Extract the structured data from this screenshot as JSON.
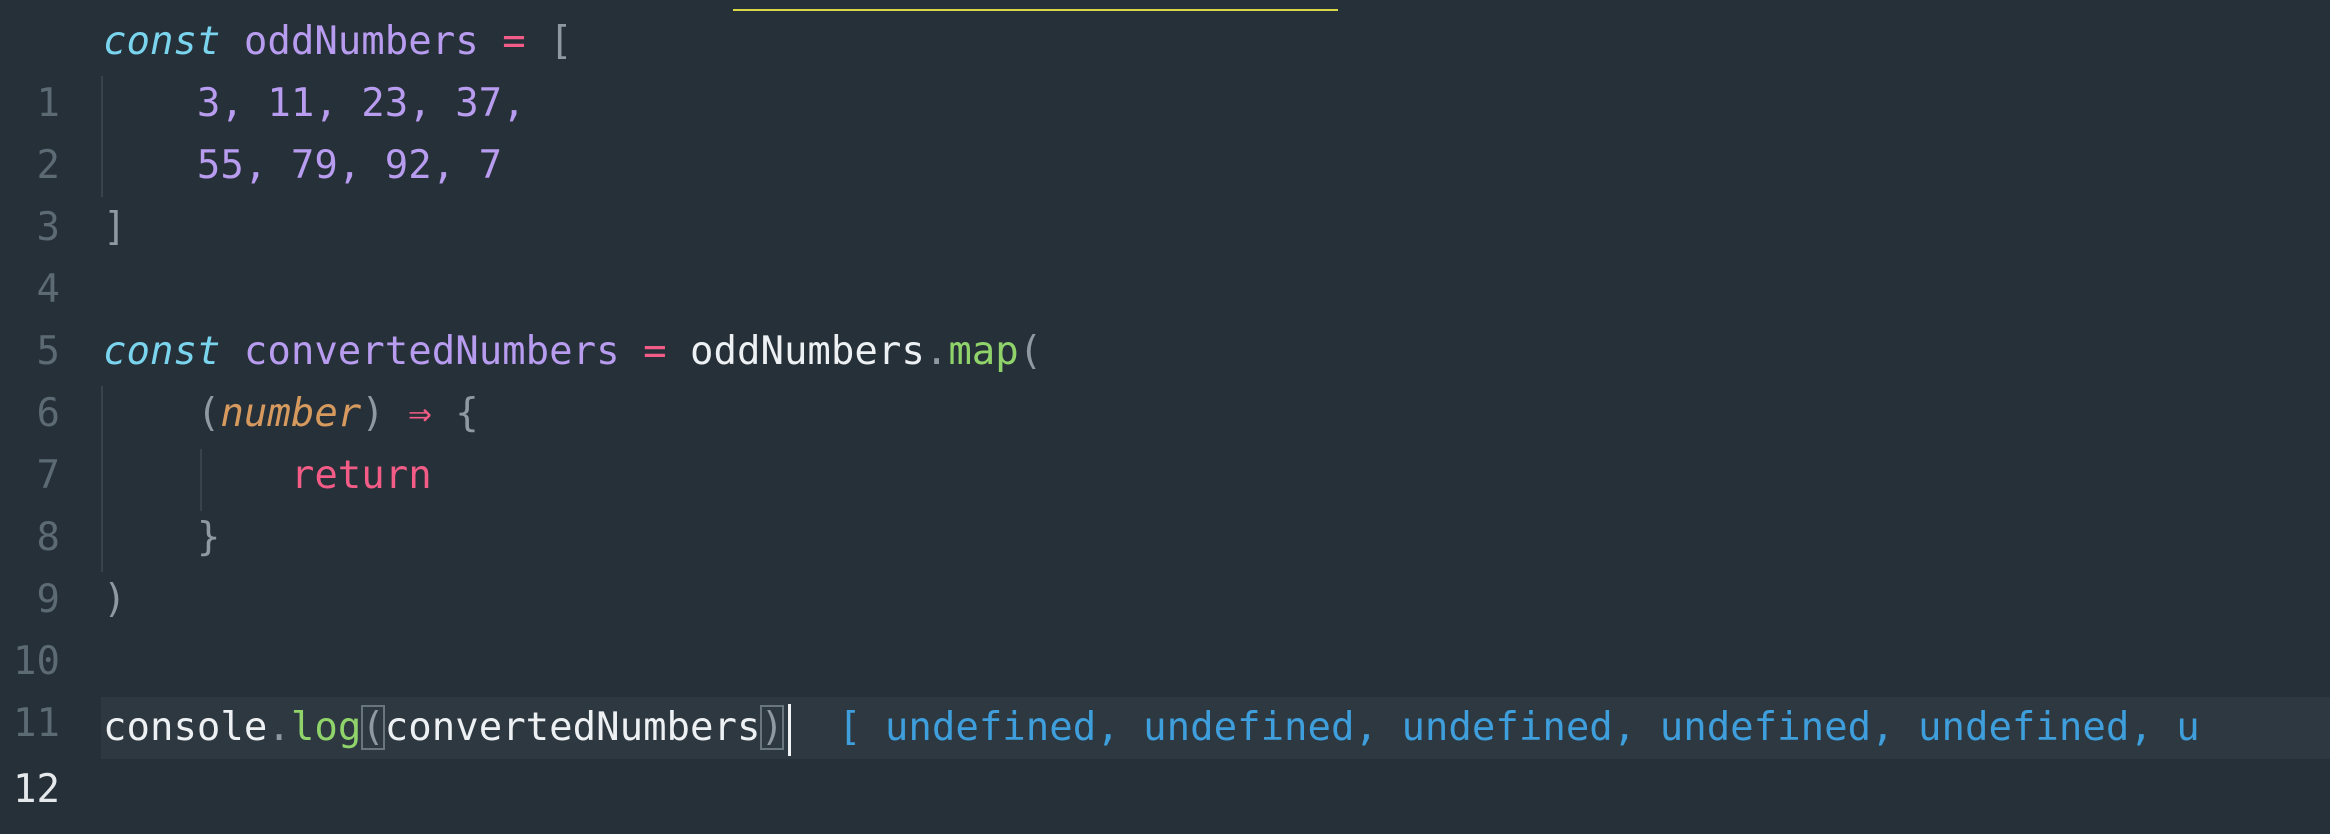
{
  "editor": {
    "line_numbers": [
      "1",
      "2",
      "3",
      "4",
      "5",
      "6",
      "7",
      "8",
      "9",
      "10",
      "11",
      "12"
    ],
    "active_line": "12",
    "tokens": {
      "l1_kw": "const",
      "l1_var": "oddNumbers",
      "l1_eq": "=",
      "l1_open": "[",
      "l2_nums": "3, 11, 23, 37,",
      "l3_nums": "55, 79, 92, 7",
      "l4_close": "]",
      "l6_kw": "const",
      "l6_var": "convertedNumbers",
      "l6_eq": "=",
      "l6_obj": "oddNumbers",
      "l6_dot": ".",
      "l6_fn": "map",
      "l6_paren": "(",
      "l7_open": "(",
      "l7_param": "number",
      "l7_close": ")",
      "l7_arrow": "⇒",
      "l7_brace": "{",
      "l8_return": "return",
      "l9_brace": "}",
      "l10_paren": ")",
      "l12_obj": "console",
      "l12_dot": ".",
      "l12_fn": "log",
      "l12_open": "(",
      "l12_arg": "convertedNumbers",
      "l12_close": ")",
      "l12_result": "[ undefined, undefined, undefined, undefined, undefined, u"
    }
  },
  "colors": {
    "background": "#263038",
    "keyword": "#7ad4ee",
    "variable": "#b89cf0",
    "operator": "#f25c86",
    "function": "#8fd36a",
    "parameter": "#d69a5e",
    "result": "#3e9fdc"
  }
}
